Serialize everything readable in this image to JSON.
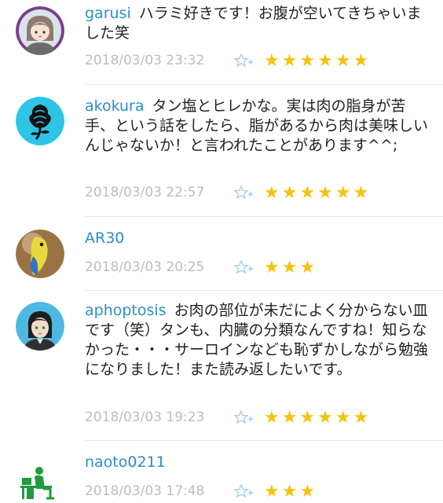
{
  "comments": [
    {
      "user": "garusi",
      "text": "ハラミ好きです！お腹が空いてきちゃいました笑",
      "date": "2018/03/03 23:32",
      "stars": "★★★★★★"
    },
    {
      "user": "akokura",
      "text": "タン塩とヒレかな。実は肉の脂身が苦手、という話をしたら、脂があるから肉は美味しいんじゃないか！と言われたことがあります^^;",
      "date": "2018/03/03 22:57",
      "stars": "★★★★★★"
    },
    {
      "user": "AR30",
      "text": "",
      "date": "2018/03/03 20:25",
      "stars": "★★★"
    },
    {
      "user": "aphoptosis",
      "text": "お肉の部位が未だによく分からない皿です（笑）タンも、内臓の分類なんですね！知らなかった・・・サーロインなども恥ずかしながら勉強になりました！また読み返したいです。",
      "date": "2018/03/03 19:23",
      "stars": "★★★★★★"
    },
    {
      "user": "naoto0211",
      "text": "",
      "date": "2018/03/03 17:48",
      "stars": "★★★"
    }
  ],
  "icons": {
    "add_star": "add-star-icon"
  },
  "colors": {
    "username": "#2a8fc6",
    "star": "#f4c20d",
    "date": "#bdbdbd",
    "add_star": "#a9cde6"
  }
}
